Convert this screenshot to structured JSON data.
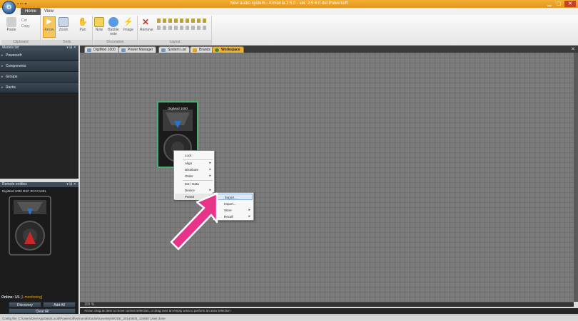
{
  "titlebar": {
    "title": "New audio system - Armonía 2.5.0 - ver. 2.5.6.0 del Powersoft",
    "qat": "▪ ↩ ▾"
  },
  "ribbon": {
    "tabs": [
      "Home",
      "View"
    ],
    "groups": {
      "clipboard": {
        "label": "Clipboard",
        "items": [
          "Paste",
          "Cut",
          "Copy"
        ]
      },
      "tools": {
        "label": "Tools",
        "items": [
          "Arrow",
          "Zoom",
          "Pan"
        ]
      },
      "decorations": {
        "label": "Decoration",
        "items": [
          "Note",
          "Bubble note",
          "Image"
        ]
      },
      "layout": {
        "label": "Layout",
        "items": [
          "Remove"
        ]
      }
    }
  },
  "left_panel": {
    "models_title": "Models list",
    "tree": [
      "Powersoft",
      "Components",
      "Groups",
      "Racks"
    ],
    "remote_title": "Remote entities",
    "remote_item": "DigiMod 1000 DSP ID:CC1491",
    "online_label": "Online: 1/1",
    "online_status": "[1 monitoring]",
    "buttons": {
      "discovery": "Discovery",
      "add_all": "Add All",
      "clear_all": "Clear All"
    },
    "panel_controls": "▾ ⊞ ✕"
  },
  "doc_tabs": [
    "DigiMod 1000",
    "Power Manager",
    "System List",
    "Brands",
    "Workspace"
  ],
  "canvas": {
    "device_label": "DigiMod 1000",
    "zoom": "100 %",
    "status": "Arrow: drag an item to move current selection, or drag over an empty area to perform an area selection"
  },
  "context_menu": {
    "items": [
      "Lock",
      "Align",
      "Distribute",
      "Order",
      "Ext / Data",
      "Device",
      "Preset"
    ],
    "submenu": [
      "Export...",
      "Import...",
      "Store",
      "Recall"
    ]
  },
  "bottombar": {
    "path": "Config file: C:\\Users\\Dev\\AppData\\Local\\Powersoft\\Armonia\\Studio\\Save\\My\\MODE_20140605_124657.pswt    done"
  },
  "colors": {
    "accent": "#f0b030",
    "selection": "#4ab070",
    "arrow": "#e8338a"
  }
}
